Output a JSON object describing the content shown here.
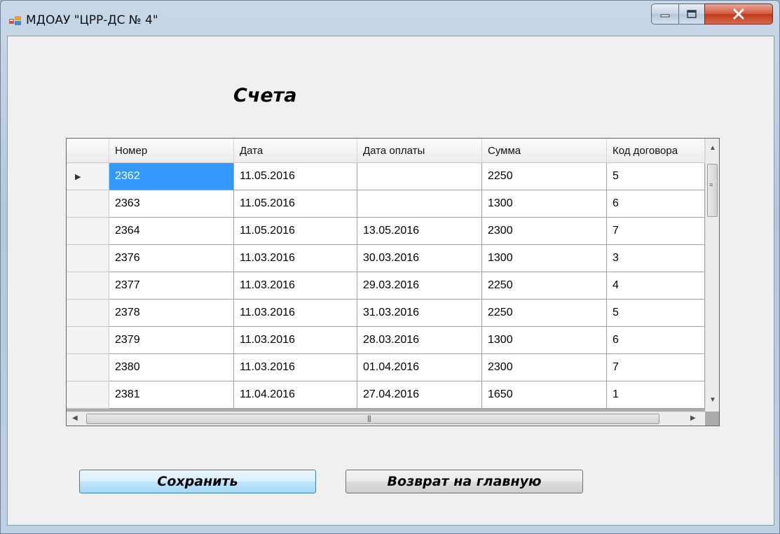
{
  "window": {
    "title": "МДОАУ \"ЦРР-ДС № 4\"",
    "icon": "form-app-icon",
    "controls": [
      "minimize-icon",
      "maximize-icon",
      "close-icon"
    ]
  },
  "heading": "Счета",
  "grid": {
    "columns": [
      "Номер",
      "Дата",
      "Дата оплаты",
      "Сумма",
      "Код договора"
    ],
    "current_row_indicator": "▶",
    "rows": [
      [
        "2362",
        "11.05.2016",
        "",
        "2250",
        "5"
      ],
      [
        "2363",
        "11.05.2016",
        "",
        "1300",
        "6"
      ],
      [
        "2364",
        "11.05.2016",
        "13.05.2016",
        "2300",
        "7"
      ],
      [
        "2376",
        "11.03.2016",
        "30.03.2016",
        "1300",
        "3"
      ],
      [
        "2377",
        "11.03.2016",
        "29.03.2016",
        "2250",
        "4"
      ],
      [
        "2378",
        "11.03.2016",
        "31.03.2016",
        "2250",
        "5"
      ],
      [
        "2379",
        "11.03.2016",
        "28.03.2016",
        "1300",
        "6"
      ],
      [
        "2380",
        "11.03.2016",
        "01.04.2016",
        "2300",
        "7"
      ],
      [
        "2381",
        "11.04.2016",
        "27.04.2016",
        "1650",
        "1"
      ]
    ],
    "selected_cell": {
      "row": 0,
      "col": 0
    },
    "selection_color": "#3399ff"
  },
  "buttons": {
    "save": "Сохранить",
    "back": "Возврат на главную"
  },
  "colors": {
    "close_button": "#c0381b",
    "selected_button_border": "#3c7fb1"
  }
}
